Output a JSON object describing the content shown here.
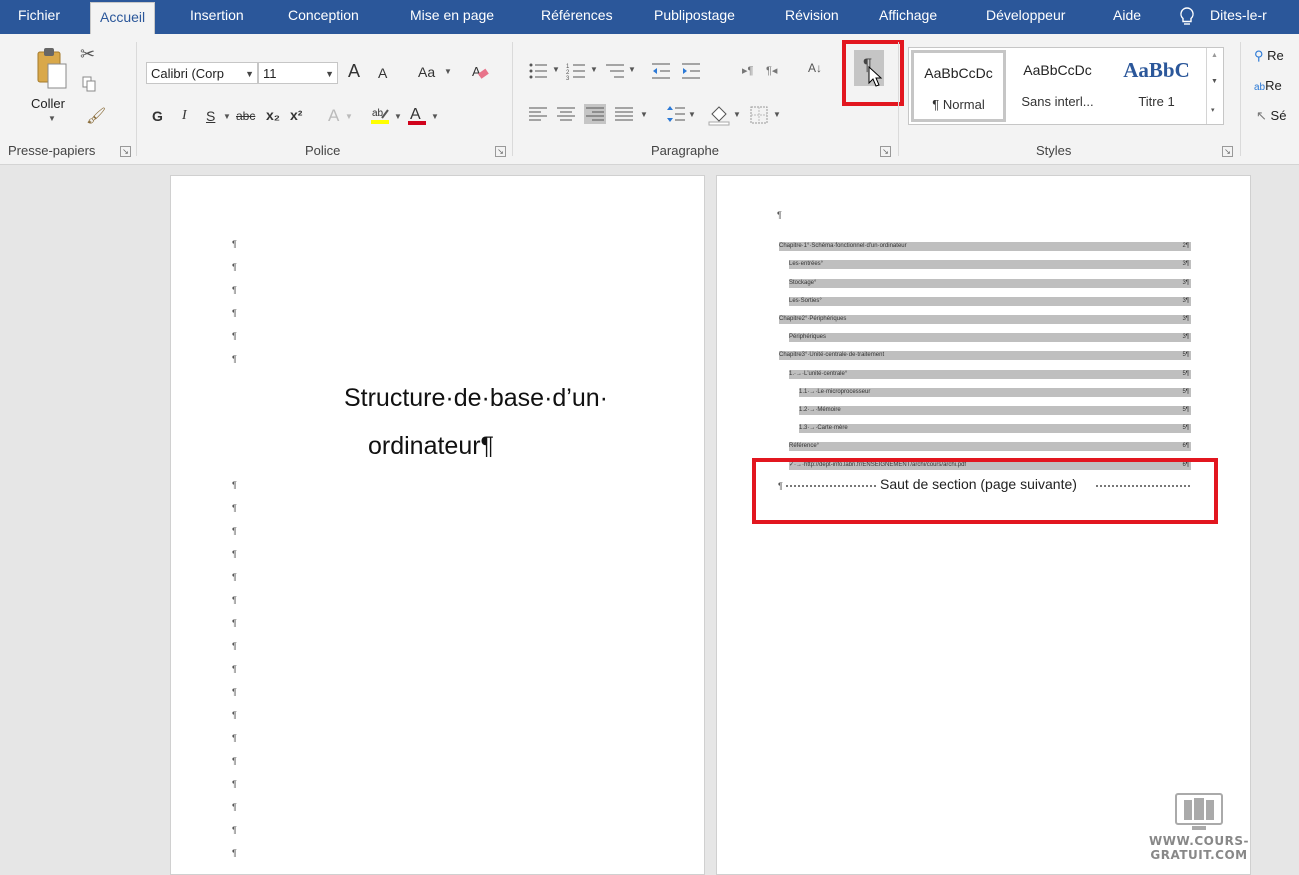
{
  "tabs": [
    {
      "label": "Fichier",
      "active": false
    },
    {
      "label": "Accueil",
      "active": true
    },
    {
      "label": "Insertion",
      "active": false
    },
    {
      "label": "Conception",
      "active": false
    },
    {
      "label": "Mise en page",
      "active": false
    },
    {
      "label": "Références",
      "active": false
    },
    {
      "label": "Publipostage",
      "active": false
    },
    {
      "label": "Révision",
      "active": false
    },
    {
      "label": "Affichage",
      "active": false
    },
    {
      "label": "Développeur",
      "active": false
    },
    {
      "label": "Aide",
      "active": false
    },
    {
      "label": "Dites-le-r",
      "active": false
    }
  ],
  "clipboard": {
    "paste_label": "Coller",
    "group_label": "Presse-papiers"
  },
  "font": {
    "name": "Calibri (Corp",
    "size": "11",
    "case_label": "Aa",
    "bold": "G",
    "italic": "I",
    "underline": "S",
    "strike": "abc",
    "subscript": "x₂",
    "superscript": "x²",
    "grow": "A",
    "shrink": "A",
    "group_label": "Police"
  },
  "paragraph": {
    "group_label": "Paragraphe",
    "show_marks_glyph": "¶",
    "sort_glyph": "A↓"
  },
  "styles": {
    "group_label": "Styles",
    "items": [
      {
        "preview": "AaBbCcDc",
        "name": "¶ Normal"
      },
      {
        "preview": "AaBbCcDc",
        "name": "Sans interl..."
      },
      {
        "preview": "AaBbC",
        "name": "Titre 1"
      }
    ]
  },
  "editing": {
    "find": "Re",
    "replace": "Re",
    "select": "Sé"
  },
  "page1": {
    "title_line1": "Structure·de·base·d’un·",
    "title_line2": "ordinateur¶",
    "mark": "¶"
  },
  "page2": {
    "top_mark": "¶",
    "toc": [
      {
        "text": "Chapitre·1°·Schéma·fonctionnel·d'un·ordinateur",
        "page": "2¶"
      },
      {
        "text": "Les·entrées°",
        "page": "3¶"
      },
      {
        "text": "Stockage°",
        "page": "3¶"
      },
      {
        "text": "Les·Sorties°",
        "page": "3¶"
      },
      {
        "text": "Chapitre2°·Périphériques",
        "page": "3¶"
      },
      {
        "text": "Périphériques",
        "page": "3¶"
      },
      {
        "text": "Chapitre3°·Unité·centrale·de·traitement",
        "page": "5¶"
      },
      {
        "text": "1.·→·L'unité·centrale°",
        "page": "5¶"
      },
      {
        "text": "1.1·→·Le·microprocesseur",
        "page": "5¶"
      },
      {
        "text": "1.2·→·Mémoire",
        "page": "5¶"
      },
      {
        "text": "1.3·→·Carte·mère",
        "page": "5¶"
      },
      {
        "text": "Référence°",
        "page": "6¶"
      },
      {
        "text": "✓·→·http://dept-info.labri.fr/ENSEIGNEMENT/archi/cours/archi.pdf",
        "page": "6¶"
      }
    ],
    "section_break_mark": "¶",
    "section_break": "Saut de section (page suivante)"
  },
  "watermark": "WWW.COURS-GRATUIT.COM",
  "colors": {
    "tabbar": "#2b579a",
    "highlight_red": "#e2161f",
    "toc_shading": "#bfbfbf"
  }
}
